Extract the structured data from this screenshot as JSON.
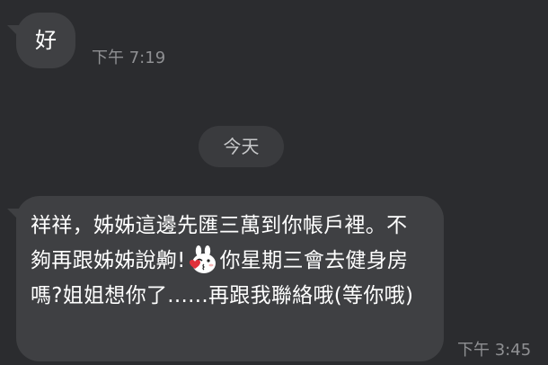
{
  "messages": [
    {
      "text": "好",
      "time": "下午 7:19"
    },
    {
      "text_part1": "祥祥，姊姊這邊先匯三萬到你帳戶裡。不夠再跟姊姊說齁!",
      "sticker": "cony-rabbit-kiss-sticker",
      "text_part2": "你星期三會去健身房嗎?姐姐想你了......再跟我聯絡哦(等你哦)",
      "time": "下午 3:45"
    }
  ],
  "date_separator": "今天",
  "colors": {
    "background": "#2b2c2f",
    "bubble": "#3f4043",
    "bubble_text": "#ffffff",
    "timestamp": "#8f9093",
    "date_pill": "#3a3b3e",
    "date_pill_text": "#c7c8ca"
  }
}
